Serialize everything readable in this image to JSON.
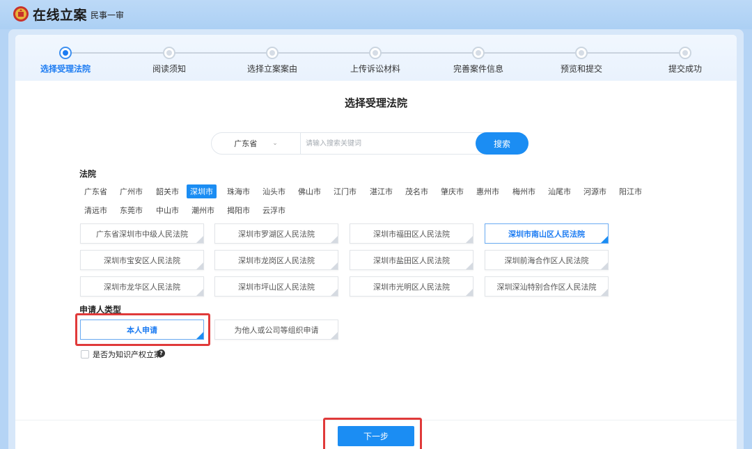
{
  "app": {
    "title": "在线立案",
    "subtitle": "民事一审"
  },
  "steps": [
    {
      "label": "选择受理法院",
      "active": true
    },
    {
      "label": "阅读须知",
      "active": false
    },
    {
      "label": "选择立案案由",
      "active": false
    },
    {
      "label": "上传诉讼材料",
      "active": false
    },
    {
      "label": "完善案件信息",
      "active": false
    },
    {
      "label": "预览和提交",
      "active": false
    },
    {
      "label": "提交成功",
      "active": false
    }
  ],
  "page_title": "选择受理法院",
  "search": {
    "province": "广东省",
    "placeholder": "请输入搜索关键词",
    "button": "搜索"
  },
  "court_section_label": "法院",
  "cities_row1": [
    "广东省",
    "广州市",
    "韶关市",
    "深圳市",
    "珠海市",
    "汕头市",
    "佛山市",
    "江门市",
    "湛江市",
    "茂名市",
    "肇庆市",
    "惠州市",
    "梅州市",
    "汕尾市",
    "河源市",
    "阳江市"
  ],
  "cities_row2": [
    "清远市",
    "东莞市",
    "中山市",
    "潮州市",
    "揭阳市",
    "云浮市"
  ],
  "selected_city": "深圳市",
  "courts": [
    "广东省深圳市中级人民法院",
    "深圳市罗湖区人民法院",
    "深圳市福田区人民法院",
    "深圳市南山区人民法院",
    "深圳市宝安区人民法院",
    "深圳市龙岗区人民法院",
    "深圳市盐田区人民法院",
    "深圳前海合作区人民法院",
    "深圳市龙华区人民法院",
    "深圳市坪山区人民法院",
    "深圳市光明区人民法院",
    "深圳深汕特别合作区人民法院"
  ],
  "selected_court": "深圳市南山区人民法院",
  "applicant_section_label": "申请人类型",
  "applicant_options": [
    "本人申请",
    "为他人或公司等组织申请"
  ],
  "selected_applicant": "本人申请",
  "ip_checkbox_label": "是否为知识产权立案",
  "help_icon_glyph": "?",
  "next_button": "下一步",
  "colors": {
    "accent": "#1b8df3",
    "highlight": "#e03a3a"
  }
}
